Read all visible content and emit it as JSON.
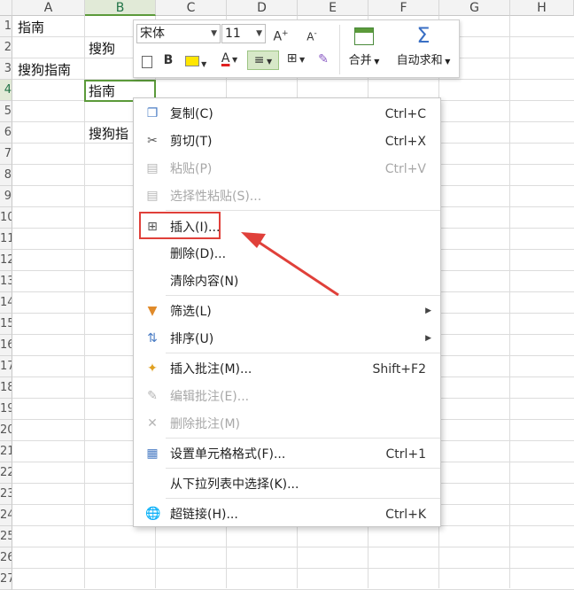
{
  "columns": [
    "A",
    "B",
    "C",
    "D",
    "E",
    "F",
    "G",
    "H"
  ],
  "active_column": "B",
  "rows": [
    "1",
    "2",
    "3",
    "4",
    "5",
    "6",
    "7",
    "8",
    "9",
    "10",
    "11",
    "12",
    "13",
    "14",
    "15",
    "16",
    "17",
    "18",
    "19",
    "20",
    "21",
    "22",
    "23",
    "24",
    "25",
    "26",
    "27"
  ],
  "cells": {
    "A1": "指南",
    "B2": "搜狗",
    "A3": "搜狗指南",
    "B4": "指南",
    "B6": "搜狗指"
  },
  "mini_toolbar": {
    "font_name": "宋体",
    "font_size": "11",
    "increase_font": "A",
    "decrease_font": "A",
    "bold": "B",
    "font_color": "A",
    "merge_label": "合并",
    "autosum_label": "自动求和",
    "autosum_symbol": "Σ"
  },
  "context_menu": {
    "items": [
      {
        "label": "复制(C)",
        "shortcut": "Ctrl+C",
        "icon": "copy-icon",
        "disabled": false
      },
      {
        "label": "剪切(T)",
        "shortcut": "Ctrl+X",
        "icon": "scissors-icon",
        "disabled": false
      },
      {
        "label": "粘贴(P)",
        "shortcut": "Ctrl+V",
        "icon": "paste-icon",
        "disabled": true
      },
      {
        "label": "选择性粘贴(S)...",
        "shortcut": "",
        "icon": "paste-special-icon",
        "disabled": true
      },
      {
        "label": "插入(I)...",
        "shortcut": "",
        "icon": "insert-icon",
        "disabled": false
      },
      {
        "label": "删除(D)...",
        "shortcut": "",
        "icon": "",
        "disabled": false
      },
      {
        "label": "清除内容(N)",
        "shortcut": "",
        "icon": "",
        "disabled": false
      },
      {
        "label": "筛选(L)",
        "shortcut": "",
        "icon": "filter-icon",
        "disabled": false,
        "submenu": true
      },
      {
        "label": "排序(U)",
        "shortcut": "",
        "icon": "sort-icon",
        "disabled": false,
        "submenu": true
      },
      {
        "label": "插入批注(M)...",
        "shortcut": "Shift+F2",
        "icon": "comment-add-icon",
        "disabled": false
      },
      {
        "label": "编辑批注(E)...",
        "shortcut": "",
        "icon": "comment-edit-icon",
        "disabled": true
      },
      {
        "label": "删除批注(M)",
        "shortcut": "",
        "icon": "comment-delete-icon",
        "disabled": true
      },
      {
        "label": "设置单元格格式(F)...",
        "shortcut": "Ctrl+1",
        "icon": "format-cells-icon",
        "disabled": false
      },
      {
        "label": "从下拉列表中选择(K)...",
        "shortcut": "",
        "icon": "",
        "disabled": false
      },
      {
        "label": "超链接(H)...",
        "shortcut": "Ctrl+K",
        "icon": "hyperlink-icon",
        "disabled": false
      }
    ],
    "highlighted": "插入(I)..."
  },
  "colors": {
    "accent_green": "#5b9a3a",
    "annotation_red": "#e0403a"
  }
}
